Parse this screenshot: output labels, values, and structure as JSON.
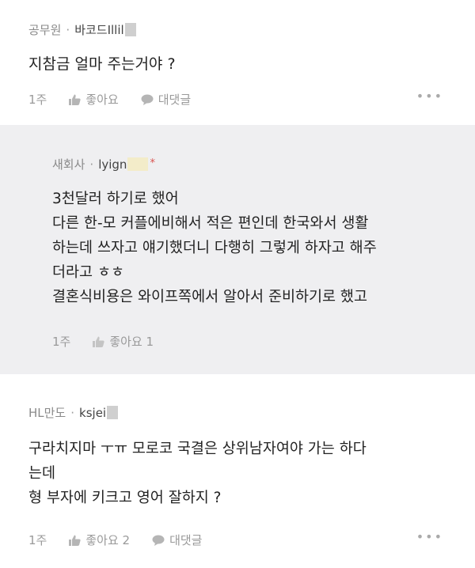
{
  "comments": [
    {
      "dept": "공무원",
      "user": "바코드Illil",
      "lines": [
        "지참금 얼마 주는거야 ?"
      ],
      "time": "1주",
      "like_label": "좋아요",
      "reply_label": "대댓글",
      "more_label": "•••"
    },
    {
      "dept": "새회사",
      "user": "lyign",
      "star": "*",
      "lines": [
        "3천달러 하기로 했어",
        "다른 한-모 커플에비해서 적은 편인데 한국와서 생활",
        "하는데 쓰자고 얘기했더니 다행히 그렇게 하자고 해주",
        "더라고 ㅎㅎ",
        "결혼식비용은 와이프쪽에서 알아서 준비하기로 했고"
      ],
      "time": "1주",
      "like_label": "좋아요 1"
    },
    {
      "dept": "HL만도",
      "user": "ksjei",
      "lines": [
        "구라치지마 ㅜㅠ 모로코 국결은 상위남자여야 가는 하다",
        "는데",
        "형 부자에 키크고 영어 잘하지 ?"
      ],
      "time": "1주",
      "like_label": "좋아요 2",
      "reply_label": "대댓글",
      "more_label": "•••"
    }
  ],
  "colors": {
    "reply_bg": "#efeff1",
    "muted": "#9a9a9a",
    "star": "#d9534f"
  },
  "icons": {
    "like": "thumbs-up-icon",
    "reply": "speech-bubble-icon",
    "more": "more-dots-icon"
  }
}
